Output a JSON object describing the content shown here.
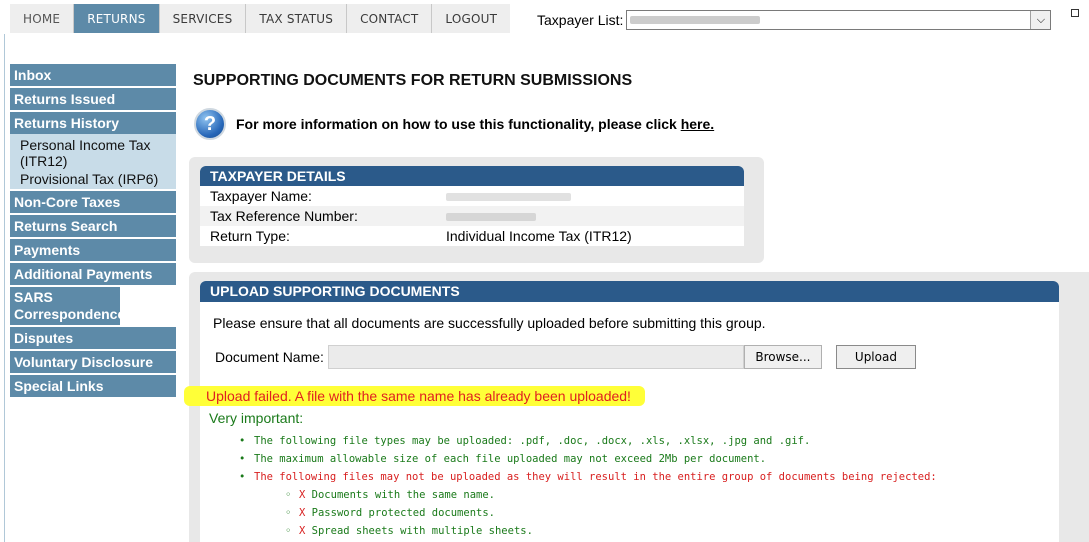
{
  "topnav": {
    "tabs": [
      {
        "label": "HOME",
        "name": "home"
      },
      {
        "label": "RETURNS",
        "name": "returns",
        "active": true
      },
      {
        "label": "SERVICES",
        "name": "services"
      },
      {
        "label": "TAX STATUS",
        "name": "tax-status"
      },
      {
        "label": "CONTACT",
        "name": "contact"
      },
      {
        "label": "LOGOUT",
        "name": "logout"
      }
    ],
    "taxpayer_list_label": "Taxpayer List:",
    "taxpayer_list_value": "",
    "active_color": "#5d8aa8"
  },
  "sidenav": {
    "items": [
      {
        "label": "Inbox"
      },
      {
        "label": "Returns Issued"
      },
      {
        "label": "Returns History",
        "subitems": [
          "Personal Income Tax (ITR12)",
          "Provisional Tax (IRP6)"
        ]
      },
      {
        "label": "Non-Core Taxes"
      },
      {
        "label": "Returns Search"
      },
      {
        "label": "Payments"
      },
      {
        "label": "Additional Payments"
      },
      {
        "label": "SARS Correspondence"
      },
      {
        "label": "Disputes"
      },
      {
        "label": "Voluntary Disclosure"
      },
      {
        "label": "Special Links"
      }
    ]
  },
  "main": {
    "title": "SUPPORTING DOCUMENTS FOR RETURN SUBMISSIONS",
    "help_text": "For more information on how to use this functionality, please click",
    "help_link": "here."
  },
  "taxpayer_details": {
    "header": "TAXPAYER DETAILS",
    "rows": [
      {
        "label": "Taxpayer Name:",
        "value": ""
      },
      {
        "label": "Tax Reference Number:",
        "value": ""
      },
      {
        "label": "Return Type:",
        "value": "Individual Income Tax (ITR12)"
      }
    ]
  },
  "upload": {
    "header": "UPLOAD SUPPORTING DOCUMENTS",
    "instruction": "Please ensure that all documents are successfully uploaded before submitting this group.",
    "doc_name_label": "Document Name:",
    "browse_label": "Browse...",
    "upload_label": "Upload",
    "error": "Upload failed. A file with the same name has already been uploaded!",
    "very_important": "Very important:",
    "notes": {
      "types_prefix": "The following file types may be uploaded: ",
      "types_list": ".pdf, .doc, .docx, .xls, .xlsx, .jpg",
      "types_and": " and ",
      "types_last": ".gif.",
      "max_size": "The maximum allowable size of each file uploaded may not exceed 2Mb per document.",
      "rejected": "The following files may not be uploaded as they will result in the entire group of documents being rejected:",
      "reject_items": [
        "Documents with the same name.",
        "Password protected documents.",
        "Spread sheets with multiple sheets."
      ],
      "x_mark": "X"
    }
  }
}
